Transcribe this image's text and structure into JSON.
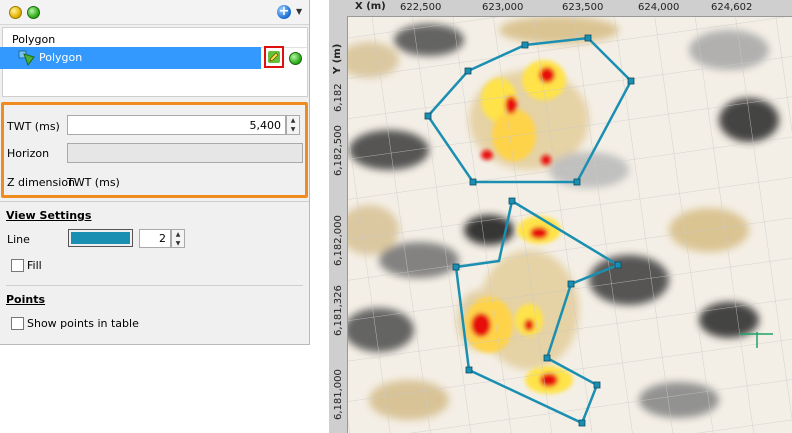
{
  "toolbar": {
    "add_icon": "plus-circle-icon",
    "menu_icon": "chevron-down-icon"
  },
  "list": {
    "header": "Polygon",
    "selected_item": "Polygon",
    "accent": "#3399ff"
  },
  "settings": {
    "twt_label": "TWT (ms)",
    "twt_value": "5,400",
    "horizon_label": "Horizon",
    "horizon_value": "",
    "zdim_label": "Z dimension",
    "zdim_value": "TWT (ms)"
  },
  "view_settings": {
    "title": "View Settings",
    "line_label": "Line",
    "line_color": "#1a8fb2",
    "line_width": "2",
    "fill_label": "Fill",
    "fill_checked": false
  },
  "points": {
    "title": "Points",
    "show_points_label": "Show points in table",
    "show_points_checked": false
  },
  "map": {
    "x_axis_title": "X (m)",
    "y_axis_title": "Y (m)",
    "x_ticks": [
      "622,500",
      "623,000",
      "623,500",
      "624,000",
      "624,602"
    ],
    "y_ticks": [
      "6,182,500",
      "6,182,000",
      "6,181,326",
      "6,181,000"
    ],
    "y_top_tick": "6,182",
    "polygon_color": "#1a8fb2"
  }
}
